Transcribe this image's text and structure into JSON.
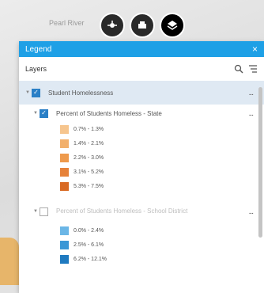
{
  "map": {
    "label": "Pearl River"
  },
  "toolbar": {
    "buttons": [
      "layers-toggle-icon",
      "print-icon",
      "basemap-icon"
    ]
  },
  "legend": {
    "title": "Legend",
    "close_label": "×",
    "layers_label": "Layers",
    "group": {
      "name": "Student Homelessness",
      "more": "..."
    },
    "layer_state": {
      "name": "Percent of Students Homeless - State",
      "more": "...",
      "items": [
        {
          "label": "0.7% - 1.3%",
          "color": "#f6c58e"
        },
        {
          "label": "1.4% - 2.1%",
          "color": "#f2b06c"
        },
        {
          "label": "2.2% - 3.0%",
          "color": "#ee9a4c"
        },
        {
          "label": "3.1% - 5.2%",
          "color": "#e6823a"
        },
        {
          "label": "5.3% - 7.5%",
          "color": "#d96a24"
        }
      ]
    },
    "layer_district": {
      "name": "Percent of Students Homeless - School District",
      "more": "...",
      "items": [
        {
          "label": "0.0% - 2.4%",
          "color": "#6bb6e6"
        },
        {
          "label": "2.5% - 6.1%",
          "color": "#3a97d6"
        },
        {
          "label": "6.2% - 12.1%",
          "color": "#1f7ac0"
        }
      ]
    }
  }
}
